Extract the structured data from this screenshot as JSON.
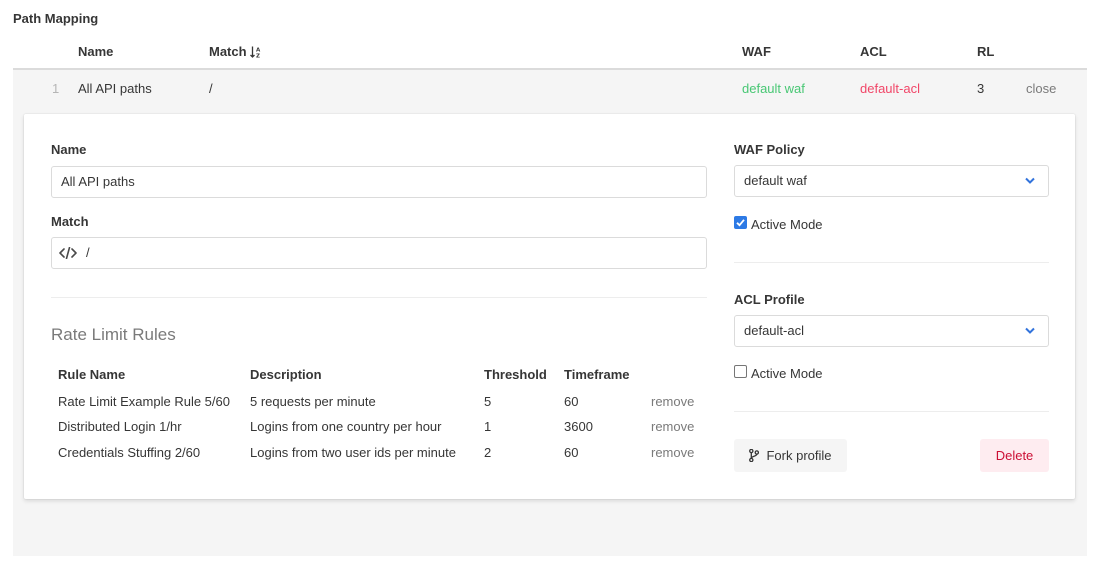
{
  "section": {
    "title": "Path Mapping"
  },
  "table": {
    "headers": {
      "name": "Name",
      "match": "Match",
      "waf": "WAF",
      "acl": "ACL",
      "rl": "RL"
    },
    "row": {
      "index": "1",
      "name": "All API paths",
      "match": "/",
      "waf": "default waf",
      "acl": "default-acl",
      "rl": "3",
      "close_label": "close"
    }
  },
  "editor": {
    "name_label": "Name",
    "name_value": "All API paths",
    "match_label": "Match",
    "match_value": "/",
    "rate_limit_title": "Rate Limit Rules",
    "rules_headers": {
      "name": "Rule Name",
      "description": "Description",
      "threshold": "Threshold",
      "timeframe": "Timeframe"
    },
    "rules": [
      {
        "name": "Rate Limit Example Rule 5/60",
        "description": "5 requests per minute",
        "threshold": "5",
        "timeframe": "60",
        "action": "remove"
      },
      {
        "name": "Distributed Login 1/hr",
        "description": "Logins from one country per hour",
        "threshold": "1",
        "timeframe": "3600",
        "action": "remove"
      },
      {
        "name": "Credentials Stuffing 2/60",
        "description": "Logins from two user ids per minute",
        "threshold": "2",
        "timeframe": "60",
        "action": "remove"
      }
    ],
    "waf_label": "WAF Policy",
    "waf_value": "default waf",
    "waf_active_label": "Active Mode",
    "waf_active_checked": true,
    "acl_label": "ACL Profile",
    "acl_value": "default-acl",
    "acl_active_label": "Active Mode",
    "acl_active_checked": false,
    "fork_label": "Fork profile",
    "delete_label": "Delete"
  },
  "colors": {
    "waf": "#48c774",
    "acl": "#f14668",
    "accent": "#2d7ae5",
    "danger": "#cc0f35"
  },
  "icons": {
    "sort": "sort-alpha-icon",
    "code": "code-icon",
    "chevron": "chevron-down-icon",
    "fork": "code-branch-icon"
  }
}
